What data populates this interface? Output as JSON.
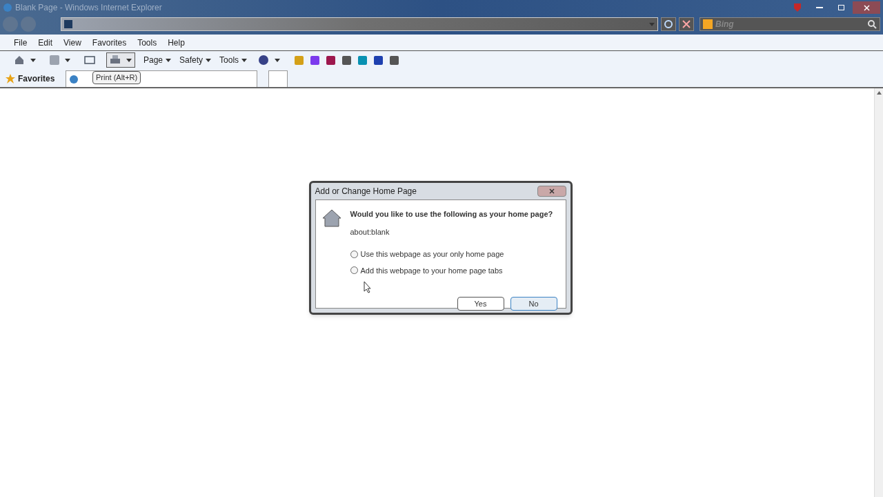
{
  "window": {
    "title": "Blank Page - Windows Internet Explorer"
  },
  "search": {
    "placeholder": "Bing"
  },
  "menu": [
    "File",
    "Edit",
    "View",
    "Favorites",
    "Tools",
    "Help"
  ],
  "command_bar": [
    {
      "kind": "icon",
      "dropdown": true
    },
    {
      "kind": "icon",
      "dropdown": true
    },
    {
      "kind": "icon",
      "dropdown": false
    },
    {
      "kind": "icon",
      "dropdown": true,
      "pressed": true
    },
    {
      "kind": "menu",
      "label": "Page"
    },
    {
      "kind": "menu",
      "label": "Safety"
    },
    {
      "kind": "menu",
      "label": "Tools"
    },
    {
      "kind": "icon",
      "dropdown": true
    }
  ],
  "favorites": {
    "label": "Favorites",
    "tooltip": "Print (Alt+R)"
  },
  "dialog": {
    "title": "Add or Change Home Page",
    "question": "Would you like to use the following as your home page?",
    "url": "about:blank",
    "options": [
      {
        "label": "Use this webpage as your only home page",
        "selected": false
      },
      {
        "label": "Add this webpage to your home page tabs",
        "selected": false
      }
    ],
    "buttons": [
      {
        "label": "Yes",
        "default": false
      },
      {
        "label": "No",
        "default": true
      }
    ]
  }
}
